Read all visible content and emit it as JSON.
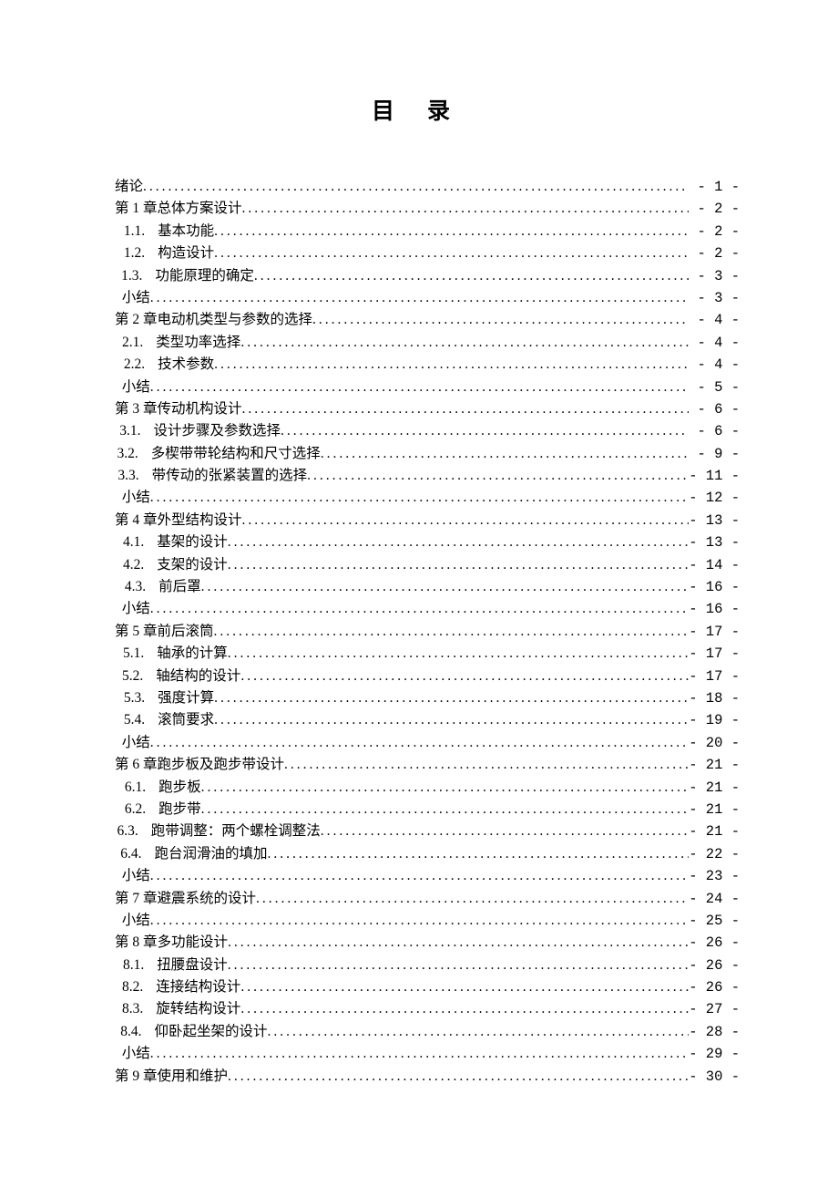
{
  "title": "目录",
  "title_display_parts": [
    "目",
    "录"
  ],
  "entries": [
    {
      "level": "lv0",
      "lead": "绪论",
      "label": "",
      "page": "1"
    },
    {
      "level": "lv1",
      "lead": "第 1 章",
      "label": "总体方案设计",
      "page": "2"
    },
    {
      "level": "lv2",
      "lead": "1.1.",
      "label": "基本功能",
      "page": "2"
    },
    {
      "level": "lv2",
      "lead": "1.2.",
      "label": "构造设计",
      "page": "2"
    },
    {
      "level": "lv2",
      "lead": "1.3.",
      "label": "功能原理的确定",
      "page": "3"
    },
    {
      "level": "lvS",
      "lead": "小结",
      "label": "",
      "page": "3"
    },
    {
      "level": "lv1",
      "lead": "第 2 章",
      "label": "电动机类型与参数的选择",
      "page": "4"
    },
    {
      "level": "lv2",
      "lead": "2.1.",
      "label": "类型功率选择",
      "page": "4"
    },
    {
      "level": "lv2",
      "lead": "2.2.",
      "label": "技术参数",
      "page": "4"
    },
    {
      "level": "lvS",
      "lead": "小结",
      "label": "",
      "page": "5"
    },
    {
      "level": "lv1",
      "lead": "第 3 章",
      "label": "传动机构设计",
      "page": "6"
    },
    {
      "level": "lv2",
      "lead": "3.1.",
      "label": "设计步骤及参数选择",
      "page": "6"
    },
    {
      "level": "lv2",
      "lead": "3.2.",
      "label": "多楔带带轮结构和尺寸选择",
      "page": "9"
    },
    {
      "level": "lv2",
      "lead": "3.3.",
      "label": "带传动的张紧装置的选择",
      "page": "11"
    },
    {
      "level": "lvS",
      "lead": "小结",
      "label": "",
      "page": "12"
    },
    {
      "level": "lv1",
      "lead": "第 4 章",
      "label": "外型结构设计",
      "page": "13"
    },
    {
      "level": "lv2",
      "lead": "4.1.",
      "label": "基架的设计",
      "page": "13"
    },
    {
      "level": "lv2",
      "lead": "4.2.",
      "label": "支架的设计",
      "page": "14"
    },
    {
      "level": "lv2",
      "lead": "4.3.",
      "label": "前后罩",
      "page": "16"
    },
    {
      "level": "lvS",
      "lead": "小结",
      "label": "",
      "page": "16"
    },
    {
      "level": "lv1",
      "lead": "第 5 章",
      "label": "前后滚筒",
      "page": "17"
    },
    {
      "level": "lv2",
      "lead": "5.1.",
      "label": "轴承的计算",
      "page": "17"
    },
    {
      "level": "lv2",
      "lead": "5.2.",
      "label": "轴结构的设计",
      "page": "17"
    },
    {
      "level": "lv2",
      "lead": "5.3.",
      "label": "强度计算",
      "page": "18"
    },
    {
      "level": "lv2",
      "lead": "5.4.",
      "label": "滚筒要求",
      "page": "19"
    },
    {
      "level": "lvS",
      "lead": "小结",
      "label": "",
      "page": "20"
    },
    {
      "level": "lv1",
      "lead": "第 6 章",
      "label": "跑步板及跑步带设计",
      "page": "21"
    },
    {
      "level": "lv2",
      "lead": "6.1.",
      "label": "跑步板",
      "page": "21"
    },
    {
      "level": "lv2",
      "lead": "6.2.",
      "label": "跑步带",
      "page": "21"
    },
    {
      "level": "lv2",
      "lead": "6.3.",
      "label": "跑带调整：两个螺栓调整法",
      "page": "21"
    },
    {
      "level": "lv2",
      "lead": "6.4.",
      "label": "跑台润滑油的填加",
      "page": "22"
    },
    {
      "level": "lvS",
      "lead": "小结",
      "label": "",
      "page": "23"
    },
    {
      "level": "lv1",
      "lead": "第 7 章",
      "label": "避震系统的设计",
      "page": "24"
    },
    {
      "level": "lvS",
      "lead": "小结",
      "label": "",
      "page": "25"
    },
    {
      "level": "lv1",
      "lead": "第 8 章",
      "label": "多功能设计",
      "page": "26"
    },
    {
      "level": "lv2",
      "lead": "8.1.",
      "label": "扭腰盘设计",
      "page": "26"
    },
    {
      "level": "lv2",
      "lead": "8.2.",
      "label": "连接结构设计",
      "page": "26"
    },
    {
      "level": "lv2",
      "lead": "8.3.",
      "label": "旋转结构设计",
      "page": "27"
    },
    {
      "level": "lv2",
      "lead": "8.4.",
      "label": "仰卧起坐架的设计",
      "page": "28"
    },
    {
      "level": "lvS",
      "lead": "小结",
      "label": "",
      "page": "29"
    },
    {
      "level": "lv1",
      "lead": "第 9 章",
      "label": "使用和维护",
      "page": "30"
    }
  ]
}
